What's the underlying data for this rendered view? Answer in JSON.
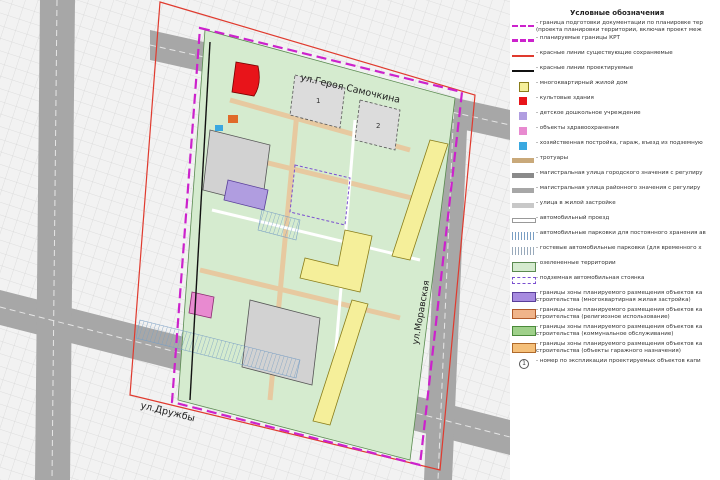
{
  "map": {
    "street_labels": {
      "samochkina": "ул.Героя Самочкина",
      "moravskaya": "ул.Моравская",
      "druzhby": "ул.Дружбы"
    },
    "building_numbers": [
      "1",
      "2"
    ],
    "colors": {
      "background": "#f2f2f2",
      "green_zone": "#d5ebcf",
      "road_gray": "#a7a7a7",
      "road_edge": "#7a7a7a",
      "planning_boundary_magenta": "#cc22cc",
      "red_line": "#e03a2e",
      "residential_yellow": "#f5ef9a",
      "education_purple": "#b09de0",
      "health_pink": "#e88ad0",
      "culture_red": "#e8141a",
      "water_blue": "#3aa8e0",
      "kindergarten_orange": "#e06a2a"
    }
  },
  "legend": {
    "title": "Условные обозначения",
    "items": [
      {
        "symbol": "dash-magenta",
        "lines": [
          "- граница подготовки документации по планировке тер",
          "(проекта планировки территории, включая проект меж"
        ]
      },
      {
        "symbol": "dash-magenta-thick",
        "lines": [
          "- планируемые границы КРТ"
        ]
      },
      {
        "symbol": "line-red",
        "lines": [
          "- красные линии существующие сохраняемые"
        ]
      },
      {
        "symbol": "line-black",
        "lines": [
          "- красные линии проектируемые"
        ]
      },
      {
        "symbol": "sq-yellow",
        "lines": [
          "- многоквартирный жилой дом"
        ]
      },
      {
        "symbol": "sq-red",
        "lines": [
          "- культовые здания"
        ]
      },
      {
        "symbol": "sq-purple",
        "lines": [
          "- детское дошкольное учреждение"
        ]
      },
      {
        "symbol": "sq-pink",
        "lines": [
          "- объекты здравоохранения"
        ]
      },
      {
        "symbol": "sq-blue",
        "lines": [
          "- хозяйственная постройка, гараж, въезд из подземную"
        ]
      },
      {
        "symbol": "bar-tan",
        "lines": [
          "- тротуары"
        ]
      },
      {
        "symbol": "bar-gray-dark",
        "lines": [
          "- магистральная улица городского значения с регулиру"
        ]
      },
      {
        "symbol": "bar-gray",
        "lines": [
          "- магистральная улица районного значения с регулиру"
        ]
      },
      {
        "symbol": "bar-gray-light",
        "lines": [
          "- улица в жилой застройке"
        ]
      },
      {
        "symbol": "bar-white",
        "lines": [
          "- автомобильный проезд"
        ]
      },
      {
        "symbol": "hatch",
        "lines": [
          "- автомобильные парковки для постоянного хранения ав"
        ]
      },
      {
        "symbol": "hatch-light",
        "lines": [
          "- гостевые автомобильные парковки (для временного х"
        ]
      },
      {
        "symbol": "sq-green",
        "lines": [
          "- озелененные территории"
        ]
      },
      {
        "symbol": "dash-purple",
        "lines": [
          "- подземная автомобильная стоянка"
        ]
      },
      {
        "symbol": "box-purple",
        "lines": [
          "- границы зоны планируемого размещения объектов ка",
          "строительства (многоквартирная жилая застройка)"
        ]
      },
      {
        "symbol": "box-orange",
        "lines": [
          "- границы зоны планируемого размещения объектов ка",
          "строительства (религиозное использование)"
        ]
      },
      {
        "symbol": "box-green",
        "lines": [
          "- границы зоны планируемого размещения объектов ка",
          "строительства (коммунальное обслуживание)"
        ]
      },
      {
        "symbol": "box-orange2",
        "lines": [
          "- границы зоны планируемого размещения объектов ка",
          "строительства (объекты гаражного назначения)"
        ]
      },
      {
        "symbol": "circle-num",
        "num": "1",
        "lines": [
          "- номер по экспликации проектируемых объектов капи"
        ]
      }
    ]
  }
}
